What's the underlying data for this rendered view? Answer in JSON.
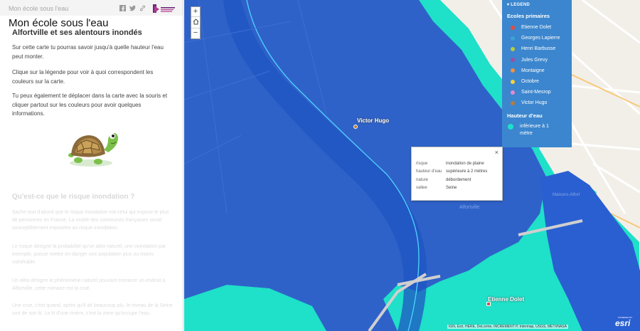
{
  "header": {
    "small_title": "Mon école sous l'eau",
    "title": "Mon école sous l'eau"
  },
  "story": {
    "section_title": "Alfortville et ses alentours inondés",
    "paragraphs": [
      "Sur cette carte tu pourras savoir jusqu'à quelle hauteur l'eau peut monter.",
      "Clique sur la légende pour voir à quoi correspondent les couleurs sur la carte.",
      "Tu peux également te déplacer dans la carte avec la souris et cliquer partout sur les couleurs pour avoir quelques informations."
    ],
    "faded_heading": "Qu'est-ce que le risque inondation ?",
    "faded_paragraphs": [
      "Sache tout d'abord que le risque inondation est celui qui expose le plus de personnes en France. La moitié des communes françaises serait susceptiblement exposées au risque inondation.",
      "Le risque désigne la probabilité qu'un aléa naturel, une inondation par exemple, puisse mettre en danger une population plus ou moins vulnérable.",
      "Un aléa désigne le phénomène naturel pouvant menacer un endroit à Alfortville, cette menace est la crue.",
      "Une crue, c'est quand, après qu'il ait beaucoup plu, le niveau de la Seine sort de son lit. Le lit d'une rivière, c'est la zone qu'occupe l'eau."
    ]
  },
  "map": {
    "zoom_in": "+",
    "zoom_out": "−",
    "labels": {
      "victor_hugo": "Victor Hugo",
      "etienne_dolet": "Etienne Dolet",
      "alfortville": "Alfortville",
      "maisons_alfort": "Maisons-Alfort"
    },
    "attribution": "IGN, Esri, HERE, DeLorme, INCREMENT P, Intermap, USGS, METI/NASA",
    "esri_small": "POWERED BY",
    "esri": "esri",
    "colors": {
      "water_deep": "#2f62c9",
      "water_mid": "#1f5fd6",
      "water_shallow": "#1fe0c8",
      "land": "#f2efe9",
      "river_line": "#4fd4ff"
    }
  },
  "legend": {
    "header": "LEGEND",
    "schools_title": "Ecoles primaires",
    "schools": [
      {
        "label": "Etienne Dolet",
        "color": "#e84a3c"
      },
      {
        "label": "Georges Lapierre",
        "color": "#3aa4d4"
      },
      {
        "label": "Henri Barbusse",
        "color": "#b7cc3c"
      },
      {
        "label": "Jules Grevy",
        "color": "#a24d9e"
      },
      {
        "label": "Montaigne",
        "color": "#f2913b"
      },
      {
        "label": "Octobre",
        "color": "#f6d23b"
      },
      {
        "label": "Saint-Mesrop",
        "color": "#e58ad0"
      },
      {
        "label": "Victor Hugo",
        "color": "#b97a3a"
      }
    ],
    "water_title": "Hauteur d'eau",
    "water_items": [
      {
        "label": "inférieure à 1 mètre",
        "color": "#1fe0c8"
      }
    ]
  },
  "popup": {
    "close": "×",
    "rows": [
      {
        "key": "risque",
        "value": "inondation de plaine"
      },
      {
        "key": "hauteur d'eau",
        "value": "supérieure à 2 mètres"
      },
      {
        "key": "nature",
        "value": "débordement"
      },
      {
        "key": "vallee",
        "value": "Seine"
      }
    ]
  }
}
